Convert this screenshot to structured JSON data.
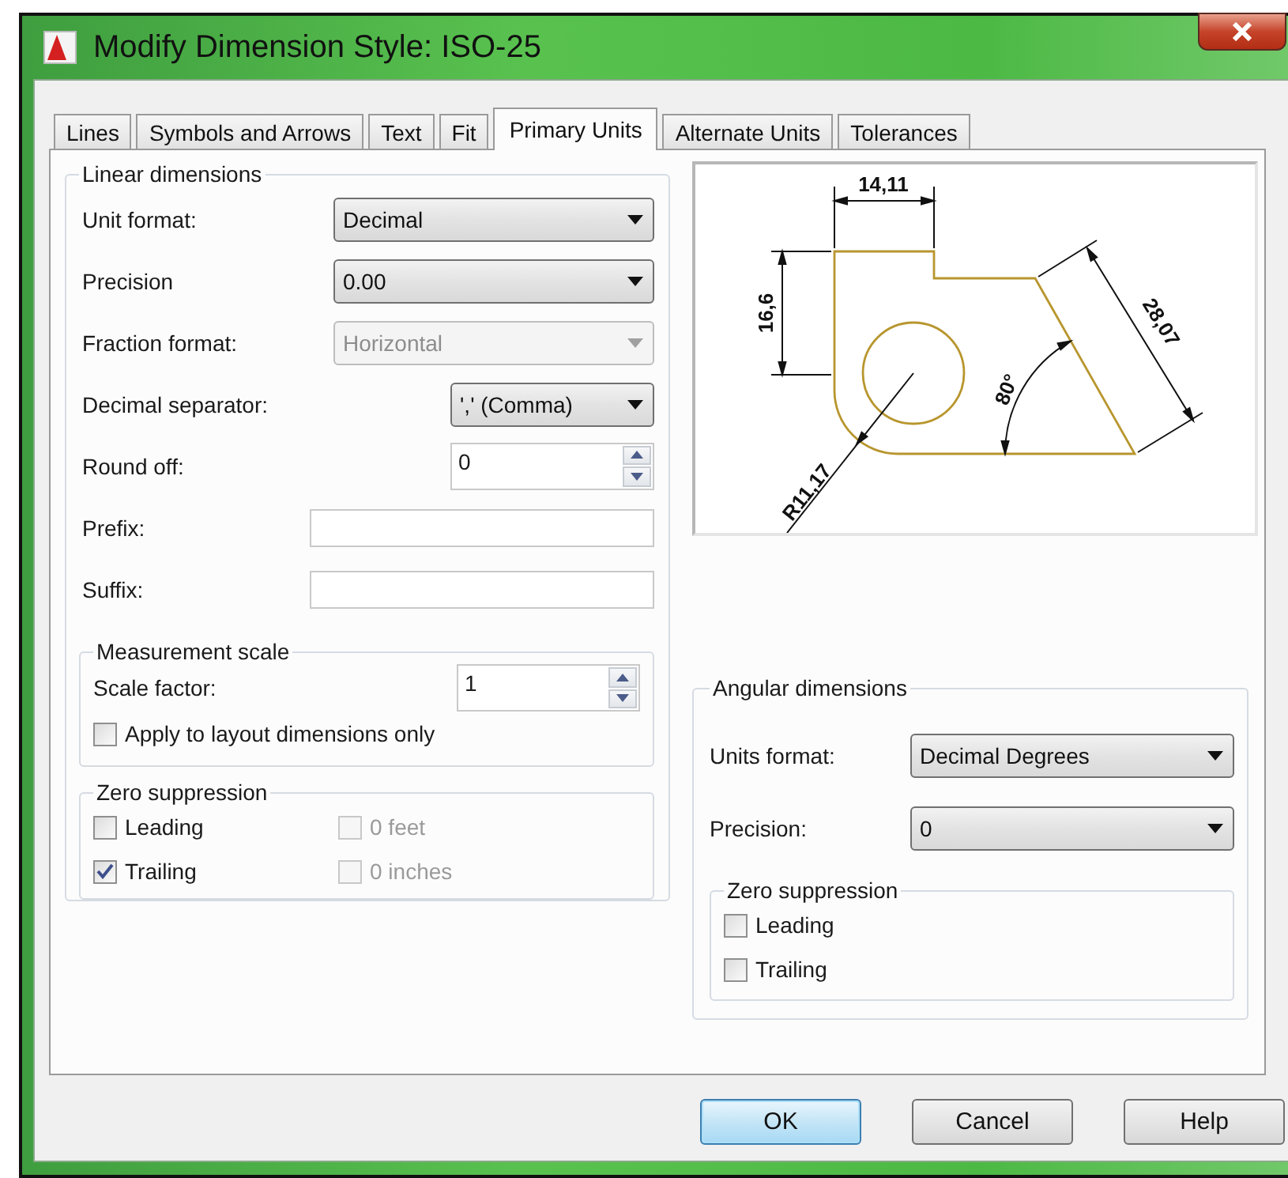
{
  "window": {
    "title": "Modify Dimension Style: ISO-25"
  },
  "tabs": [
    {
      "label": "Lines",
      "selected": false
    },
    {
      "label": "Symbols and Arrows",
      "selected": false
    },
    {
      "label": "Text",
      "selected": false
    },
    {
      "label": "Fit",
      "selected": false
    },
    {
      "label": "Primary Units",
      "selected": true
    },
    {
      "label": "Alternate Units",
      "selected": false
    },
    {
      "label": "Tolerances",
      "selected": false
    }
  ],
  "linear_dimensions": {
    "title": "Linear dimensions",
    "fields": [
      {
        "kind": "dropdown",
        "label": "Unit format:",
        "value": "Decimal",
        "disabled": false
      },
      {
        "kind": "dropdown",
        "label": "Precision",
        "value": "0.00",
        "disabled": false
      },
      {
        "kind": "dropdown",
        "label": "Fraction format:",
        "value": "Horizontal",
        "disabled": true
      },
      {
        "kind": "dropdown",
        "label": "Decimal separator:",
        "value": "',' (Comma)",
        "disabled": false
      },
      {
        "kind": "spinner",
        "label": "Round off:",
        "value": "0"
      },
      {
        "kind": "text",
        "label": "Prefix:"
      },
      {
        "kind": "text",
        "label": "Suffix:"
      }
    ],
    "measurement_scale": {
      "title": "Measurement scale",
      "scale_factor": {
        "label": "Scale factor:",
        "value": "1"
      },
      "apply_to_layout": {
        "label": "Apply to layout dimensions only",
        "checked": false
      }
    },
    "zero_suppression": {
      "title": "Zero suppression",
      "options": [
        {
          "label": "Leading",
          "checked": false,
          "disabled": false
        },
        {
          "label": "0 feet",
          "checked": false,
          "disabled": true
        },
        {
          "label": "Trailing",
          "checked": true,
          "disabled": false
        },
        {
          "label": "0 inches",
          "checked": false,
          "disabled": true
        }
      ]
    }
  },
  "preview": {
    "labels": [
      "14,11",
      "16,6",
      "28,07",
      "80°",
      "R11,17"
    ]
  },
  "angular_dimensions": {
    "title": "Angular dimensions",
    "fields": [
      {
        "kind": "dropdown",
        "label": "Units format:",
        "value": "Decimal Degrees",
        "disabled": false
      },
      {
        "kind": "dropdown",
        "label": "Precision:",
        "value": "0",
        "disabled": false
      }
    ],
    "zero_suppression": {
      "title": "Zero suppression",
      "options": [
        {
          "label": "Leading",
          "checked": false,
          "disabled": false
        },
        {
          "label": "Trailing",
          "checked": false,
          "disabled": false
        }
      ]
    }
  },
  "buttons": [
    {
      "label": "OK",
      "default": true
    },
    {
      "label": "Cancel",
      "default": false
    },
    {
      "label": "Help",
      "default": false
    }
  ]
}
